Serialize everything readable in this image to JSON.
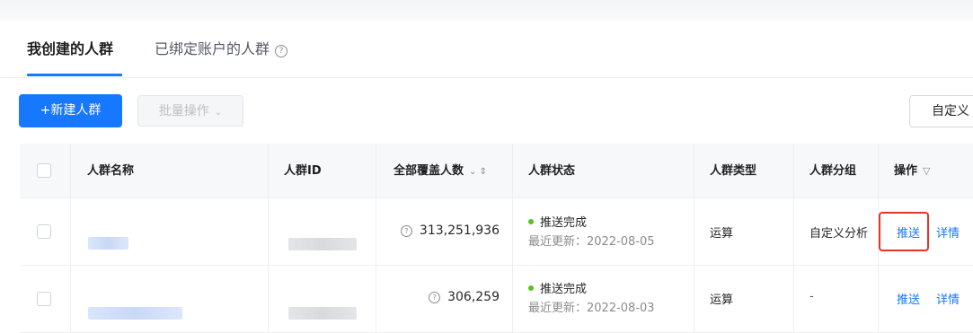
{
  "tabs": {
    "active": "我创建的人群",
    "inactive": "已绑定账户的人群",
    "help_glyph": "?"
  },
  "toolbar": {
    "new_label": "+新建人群",
    "batch_label": "批量操作",
    "batch_chevron": "⌄",
    "custom_label": "自定义"
  },
  "table": {
    "headers": {
      "name": "人群名称",
      "id": "人群ID",
      "coverage": "全部覆盖人数",
      "coverage_sort": "⌄ ⇕",
      "status": "人群状态",
      "type": "人群类型",
      "group": "人群分组",
      "action": "操作",
      "action_filter": "▽"
    },
    "rows": [
      {
        "coverage": "313,251,936",
        "status": "推送完成",
        "updated": "最近更新：2022-08-05",
        "type": "运算",
        "group": "自定义分析",
        "push": "推送",
        "detail": "详情"
      },
      {
        "coverage": "306,259",
        "status": "推送完成",
        "updated": "最近更新：2022-08-03",
        "type": "运算",
        "group": "-",
        "push": "推送",
        "detail": "详情"
      }
    ],
    "question_glyph": "?"
  },
  "colors": {
    "primary": "#1677ff",
    "status_success": "#52c41a",
    "highlight_border": "#e5342a"
  }
}
